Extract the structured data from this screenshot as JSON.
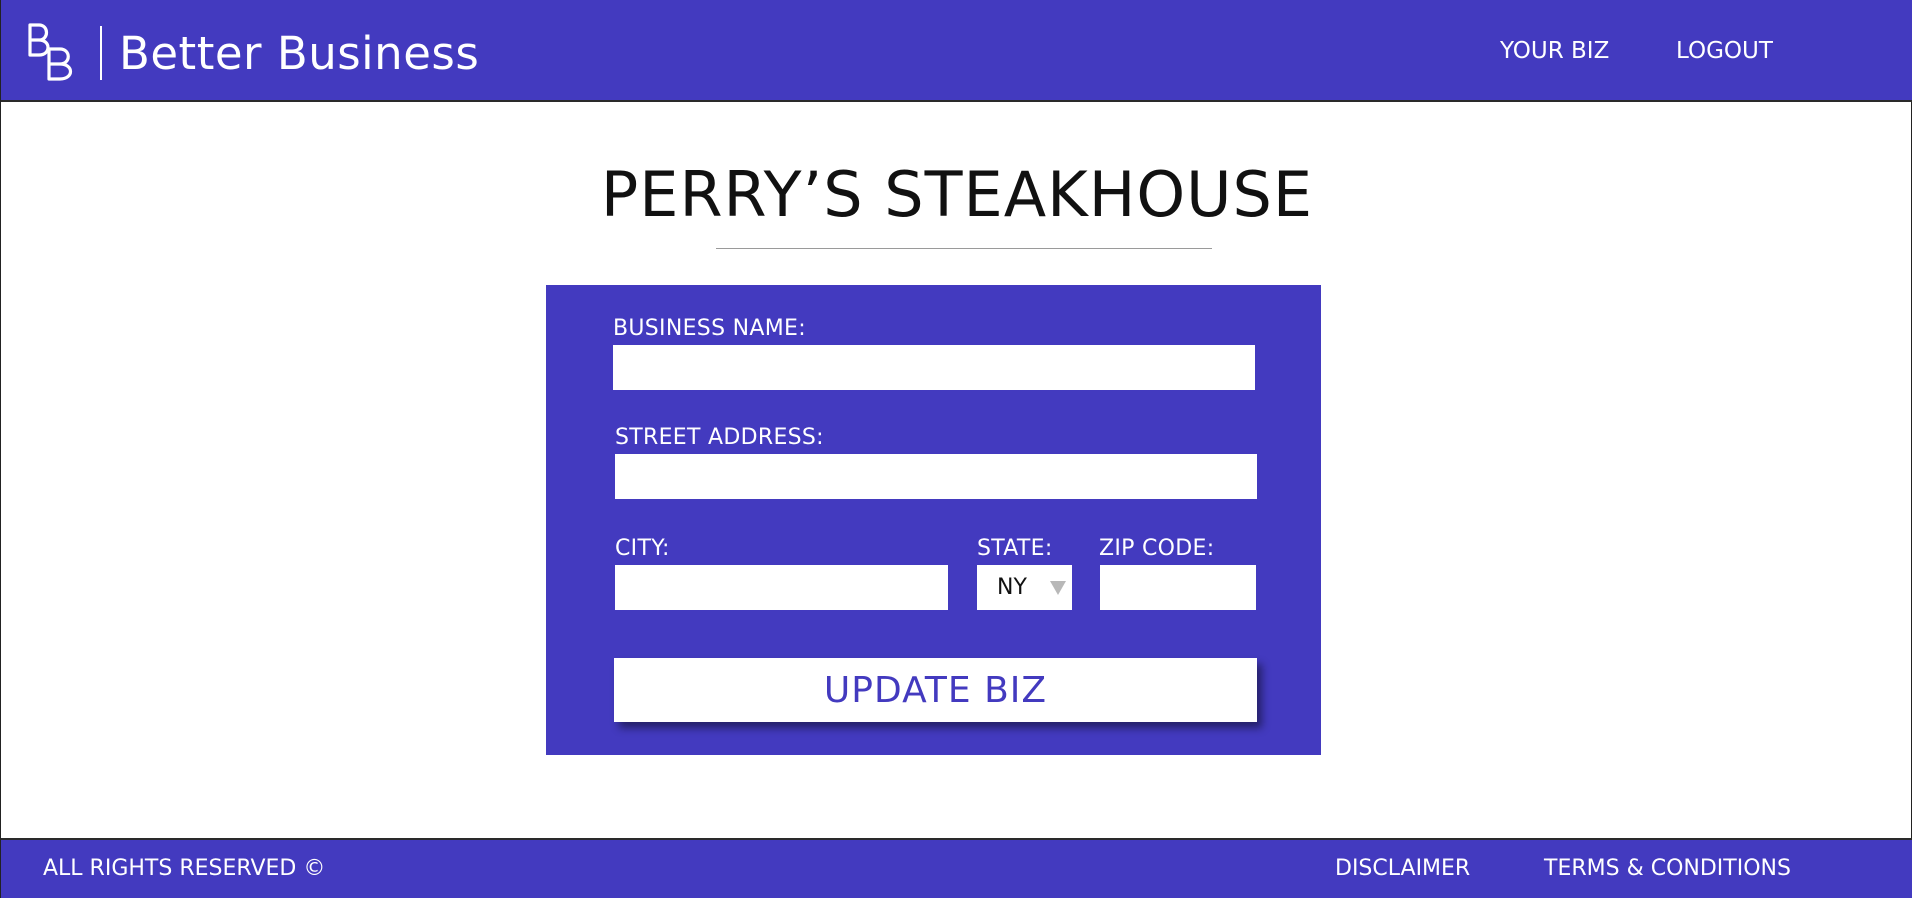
{
  "header": {
    "brand": "Better Business",
    "logo_icon": "bb-monogram-logo",
    "nav": [
      {
        "label": "YOUR BIZ"
      },
      {
        "label": "LOGOUT"
      }
    ]
  },
  "main": {
    "title": "PERRY’S STEAKHOUSE"
  },
  "form": {
    "business_name": {
      "label": "BUSINESS NAME:",
      "value": ""
    },
    "street_address": {
      "label": "STREET ADDRESS:",
      "value": ""
    },
    "city": {
      "label": "CITY:",
      "value": ""
    },
    "state": {
      "label": "STATE:",
      "selected": "NY"
    },
    "zip": {
      "label": "ZIP CODE:",
      "value": ""
    },
    "submit_label": "UPDATE BIZ"
  },
  "footer": {
    "rights": "ALL RIGHTS RESERVED ©",
    "links": [
      {
        "label": "DISCLAIMER"
      },
      {
        "label": "TERMS & CONDITIONS"
      }
    ]
  },
  "colors": {
    "brand": "#433abf",
    "surface": "#ffffff",
    "text_dark": "#111111",
    "divider": "#9a9a9a"
  }
}
